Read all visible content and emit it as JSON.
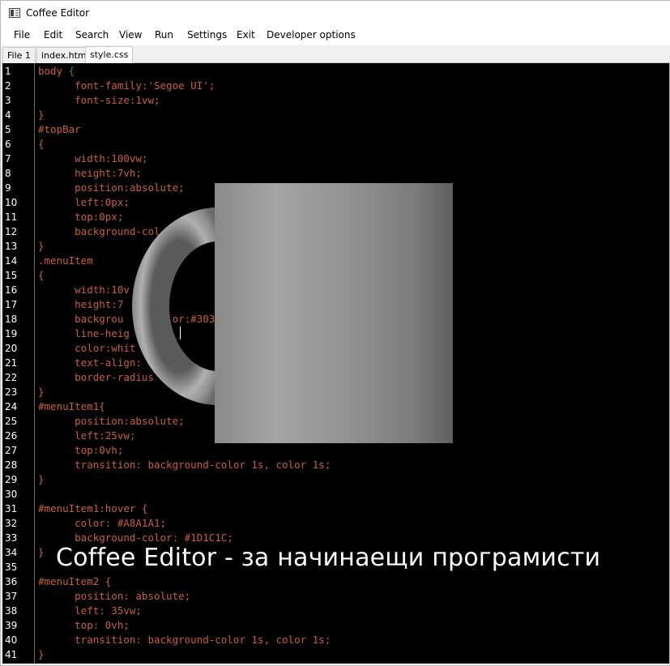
{
  "window": {
    "title": "Coffee Editor"
  },
  "menu": {
    "items": [
      "File",
      "Edit",
      "Search",
      "View",
      "Run",
      "Settings",
      "Exit",
      "Developer options"
    ]
  },
  "tabs": [
    "File 1",
    "index.html",
    "style.css"
  ],
  "active_tab": "style.css",
  "editor": {
    "line_numbers": [
      "1",
      "2",
      "3",
      "4",
      "5",
      "6",
      "7",
      "8",
      "9",
      "10",
      "11",
      "12",
      "13",
      "14",
      "15",
      "16",
      "17",
      "18",
      "19",
      "20",
      "21",
      "22",
      "23",
      "24",
      "25",
      "26",
      "27",
      "28",
      "29",
      "30",
      "31",
      "32",
      "33",
      "34",
      "35",
      "36",
      "37",
      "38",
      "39",
      "40",
      "41"
    ],
    "visible_code": {
      "1": "body {",
      "2": "      font-family:'Segoe UI';",
      "3": "      font-size:1vw;",
      "4": "}",
      "5": "#topBar",
      "6": "{",
      "7": "      width:100vw;",
      "8": "      height:7vh;",
      "9": "      position:absolute;",
      "10": "      left:0px;",
      "11": "      top:0px;",
      "12": "      background-col",
      "13": "}",
      "14": ".menuItem",
      "15": "{",
      "16": "      width:10v",
      "17": "      height:7",
      "18": "      backgrou        or:#303",
      "19": "      line-heig",
      "20": "      color:whit",
      "21": "      text-align:",
      "22": "      border-radius",
      "23": "}",
      "24": "#menuItem1{",
      "25": "      position:absolute;",
      "26": "      left:25vw;",
      "27": "      top:0vh;",
      "28": "      transition: background-color 1s, color 1s;",
      "29": "}",
      "30": "",
      "31": "#menuItem1:hover {",
      "32": "      color: #A8A1A1;",
      "33": "      background-color: #1D1C1C;",
      "34": "}",
      "35": "",
      "36": "#menuItem2 {",
      "37": "      position: absolute;",
      "38": "      left: 35vw;",
      "39": "      top: 0vh;",
      "40": "      transition: background-color 1s, color 1s;",
      "41": "}"
    },
    "green_lines": [
      "1"
    ],
    "colors": {
      "background": "#000000",
      "code_text": "#c8603a",
      "brace_green": "#3a8c2e",
      "line_number": "#ffffff"
    }
  },
  "splash": {
    "caption": "Coffee Editor - за начинаещи програмисти",
    "image": "coffee-mug-icon"
  }
}
